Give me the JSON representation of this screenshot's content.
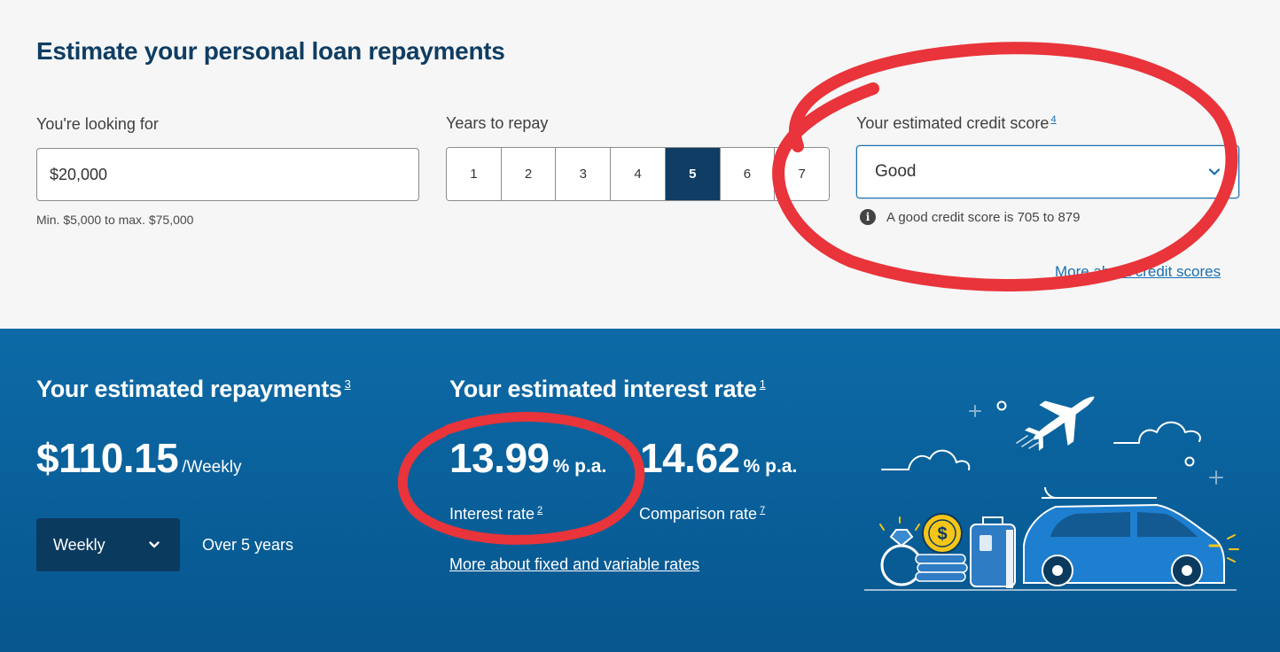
{
  "calculator": {
    "title": "Estimate your personal loan repayments",
    "amount": {
      "label": "You're looking for",
      "value": "$20,000",
      "hint": "Min. $5,000 to max. $75,000"
    },
    "years": {
      "label": "Years to repay",
      "options": [
        "1",
        "2",
        "3",
        "4",
        "5",
        "6",
        "7"
      ],
      "selected": "5"
    },
    "credit": {
      "label": "Your estimated credit score",
      "footnote": "4",
      "selected": "Good",
      "info_text": "A good credit score is 705 to 879",
      "more_link": "More about credit scores"
    }
  },
  "results": {
    "repayments": {
      "heading": "Your estimated repayments",
      "footnote": "3",
      "amount": "$110.15",
      "unit": "/Weekly",
      "frequency_select": "Weekly",
      "duration_text": "Over 5 years"
    },
    "interest": {
      "heading": "Your estimated interest rate",
      "footnote": "1",
      "interest_rate": "13.99",
      "interest_unit": "% p.a.",
      "interest_label": "Interest rate",
      "interest_footnote": "2",
      "comparison_rate": "14.62",
      "comparison_unit": "% p.a.",
      "comparison_label": "Comparison rate",
      "comparison_footnote": "7",
      "more_link": "More about fixed and variable rates"
    },
    "illustration": {
      "coin_symbol": "$"
    }
  },
  "colors": {
    "title": "#0f3d63",
    "selected_year": "#0f3d63",
    "link": "#1b6fb0",
    "bottom_bg": "#0a639f",
    "select_dark": "#0b3a5f",
    "annotation_red": "#e8343a",
    "coin_yellow": "#f5c518"
  },
  "icons": {
    "chevron": "chevron-down-icon",
    "info": "info-icon",
    "plane": "airplane-icon",
    "car": "car-icon"
  }
}
